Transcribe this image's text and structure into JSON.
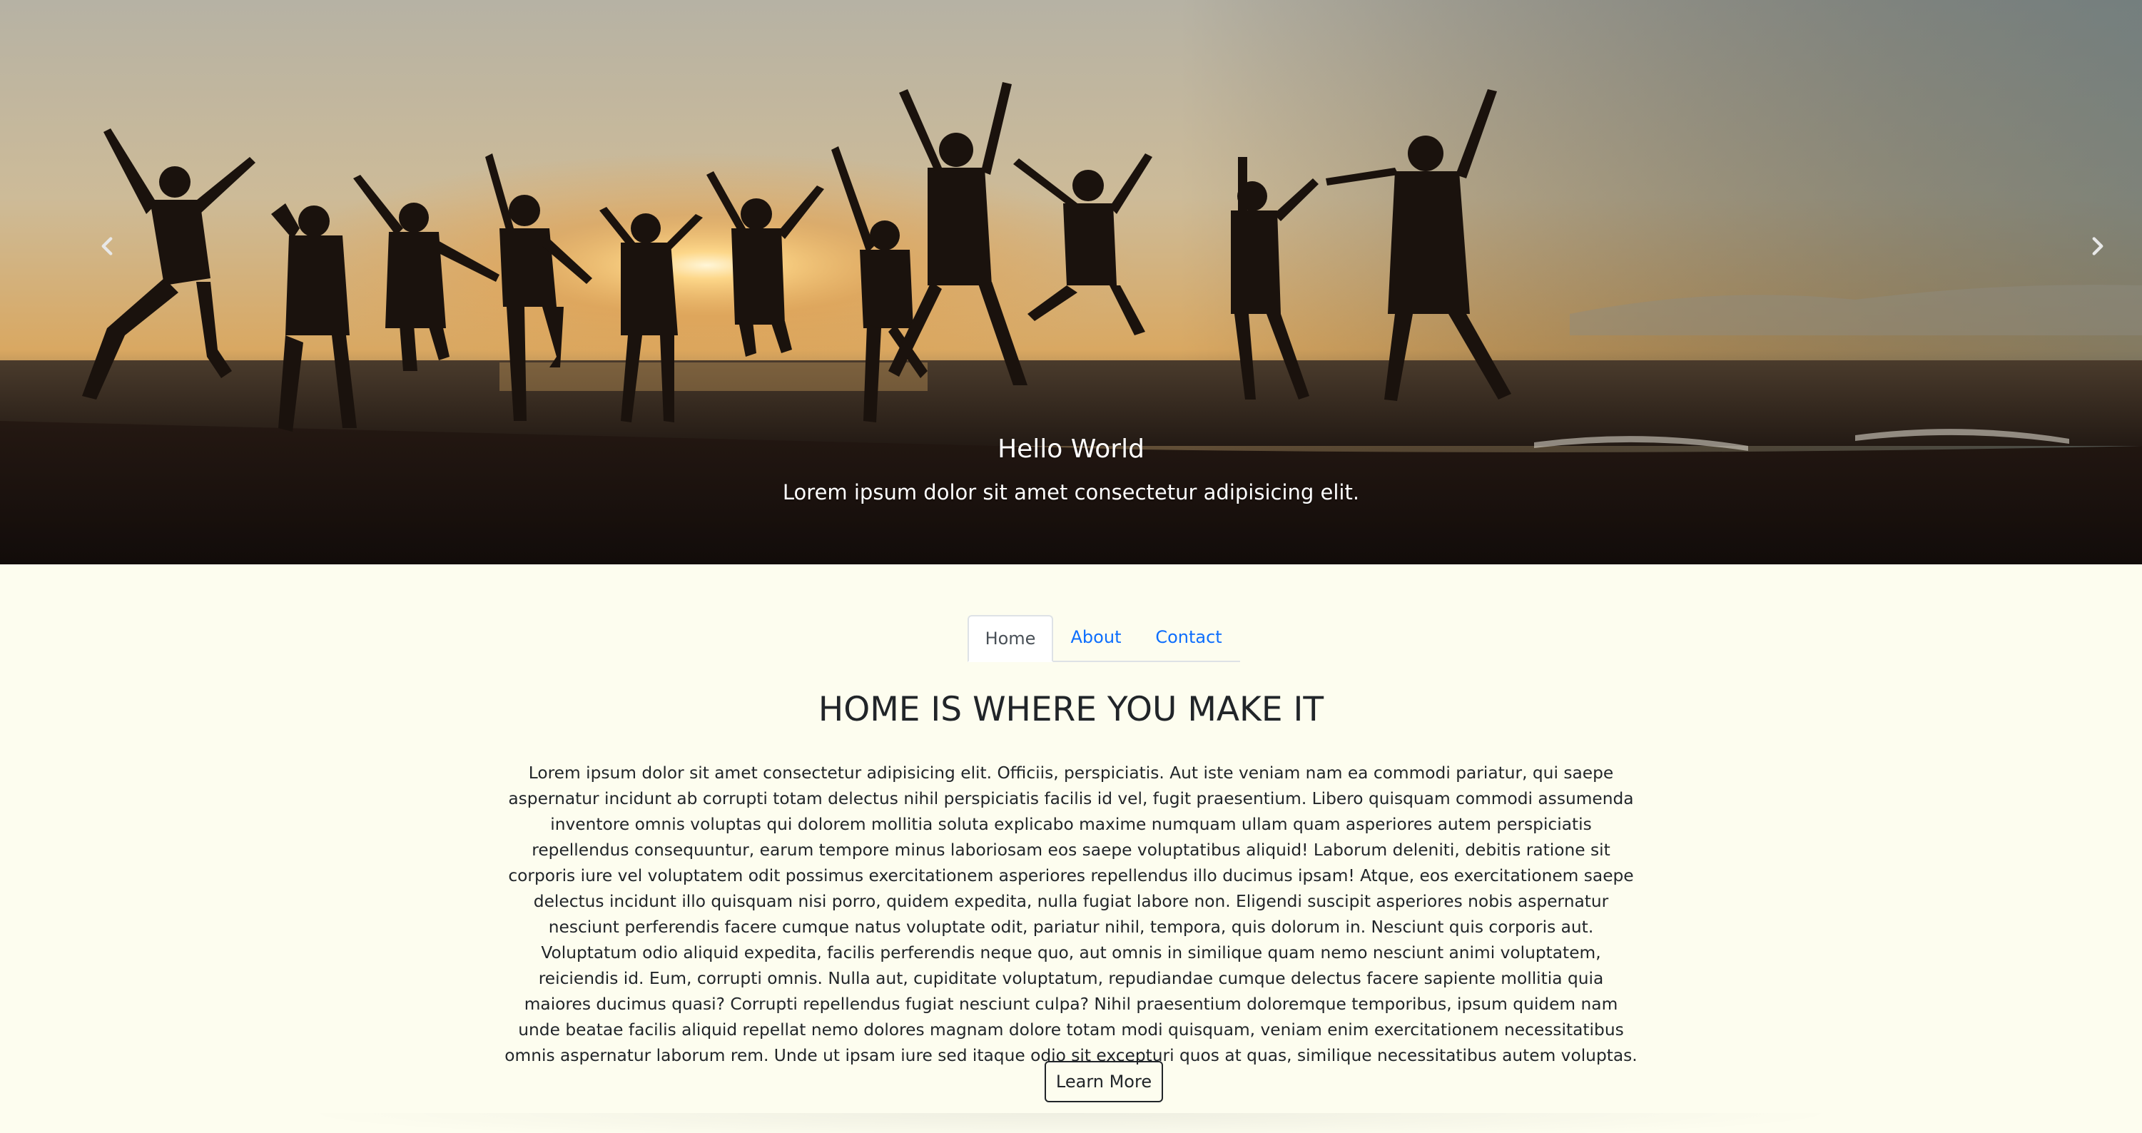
{
  "hero": {
    "image_alt": "Silhouettes of people jumping on a beach at sunset",
    "caption_title": "Hello World",
    "caption_text": "Lorem ipsum dolor sit amet consectetur adipisicing elit.",
    "prev_icon": "chevron-left-icon",
    "next_icon": "chevron-right-icon"
  },
  "tabs": [
    {
      "label": "Home",
      "active": true
    },
    {
      "label": "About",
      "active": false
    },
    {
      "label": "Contact",
      "active": false
    }
  ],
  "main": {
    "heading": "HOME IS WHERE YOU MAKE IT",
    "body": "Lorem ipsum dolor sit amet consectetur adipisicing elit. Officiis, perspiciatis. Aut iste veniam nam ea commodi pariatur, qui saepe aspernatur incidunt ab corrupti totam delectus nihil perspiciatis facilis id vel, fugit praesentium. Libero quisquam commodi assumenda inventore omnis voluptas qui dolorem mollitia soluta explicabo maxime numquam ullam quam asperiores autem perspiciatis repellendus consequuntur, earum tempore minus laboriosam eos saepe voluptatibus aliquid! Laborum deleniti, debitis ratione sit corporis iure vel voluptatem odit possimus exercitationem asperiores repellendus illo ducimus ipsam! Atque, eos exercitationem saepe delectus incidunt illo quisquam nisi porro, quidem expedita, nulla fugiat labore non. Eligendi suscipit asperiores nobis aspernatur nesciunt perferendis facere cumque natus voluptate odit, pariatur nihil, tempora, quis dolorum in. Nesciunt quis corporis aut. Voluptatum odio aliquid expedita, facilis perferendis neque quo, aut omnis in similique quam nemo nesciunt animi voluptatem, reiciendis id. Eum, corrupti omnis. Nulla aut, cupiditate voluptatum, repudiandae cumque delectus facere sapiente mollitia quia maiores ducimus quasi? Corrupti repellendus fugiat nesciunt culpa? Nihil praesentium doloremque temporibus, ipsum quidem nam unde beatae facilis aliquid repellat nemo dolores magnam dolore totam modi quisquam, veniam enim exercitationem necessitatibus omnis aspernatur laborum rem. Unde ut ipsam iure sed itaque odio sit excepturi quos at quas, similique necessitatibus autem voluptas.",
    "button_label": "Learn More"
  },
  "colors": {
    "page_background": "#fdfdef",
    "link": "#0d6efd",
    "text": "#212529",
    "tab_active_text": "#495057"
  }
}
